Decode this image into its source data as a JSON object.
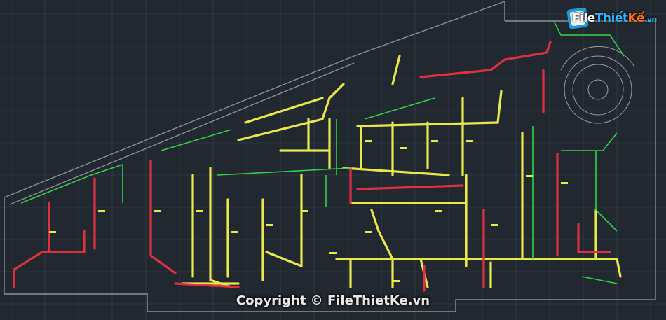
{
  "watermark": {
    "part1": "File",
    "part2": "Thiết",
    "part3": "Kế",
    "part4": ".vn"
  },
  "copyright": "Copyright © FileThietKe.vn",
  "colors": {
    "background": "#212830",
    "grid": "#3a4350",
    "wall": "#8a8f98",
    "duct_yellow": "#e8e84a",
    "duct_red": "#e03040",
    "duct_green": "#35d04a",
    "structure": "#9aa0a8"
  },
  "icons": [
    "file-logo-icon"
  ]
}
